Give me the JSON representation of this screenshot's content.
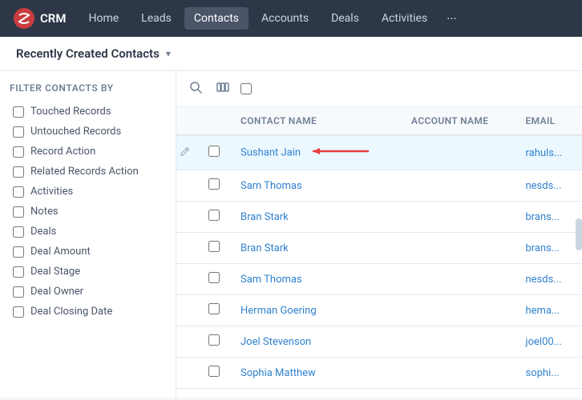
{
  "app": {
    "logo_text": "CRM",
    "nav_items": [
      {
        "label": "Home",
        "active": false
      },
      {
        "label": "Leads",
        "active": false
      },
      {
        "label": "Contacts",
        "active": true
      },
      {
        "label": "Accounts",
        "active": false
      },
      {
        "label": "Deals",
        "active": false
      },
      {
        "label": "Activities",
        "active": false
      }
    ],
    "nav_more": "···"
  },
  "sub_header": {
    "title": "Recently Created Contacts",
    "arrow": "▾"
  },
  "sidebar": {
    "title": "Filter Contacts by",
    "filters": [
      {
        "label": "Touched Records"
      },
      {
        "label": "Untouched Records"
      },
      {
        "label": "Record Action"
      },
      {
        "label": "Related Records Action"
      },
      {
        "label": "Activities"
      },
      {
        "label": "Notes"
      },
      {
        "label": "Deals"
      },
      {
        "label": "Deal Amount"
      },
      {
        "label": "Deal Stage"
      },
      {
        "label": "Deal Owner"
      },
      {
        "label": "Deal Closing Date"
      }
    ]
  },
  "table": {
    "columns": [
      {
        "key": "name",
        "label": "Contact Name"
      },
      {
        "key": "account",
        "label": "Account Name"
      },
      {
        "key": "email",
        "label": "Email"
      }
    ],
    "rows": [
      {
        "name": "Sushant Jain",
        "account": "",
        "email": "rahuls...",
        "highlighted": true
      },
      {
        "name": "Sam Thomas",
        "account": "",
        "email": "nesds...",
        "highlighted": false
      },
      {
        "name": "Bran Stark",
        "account": "",
        "email": "brans...",
        "highlighted": false
      },
      {
        "name": "Bran Stark",
        "account": "",
        "email": "brans...",
        "highlighted": false
      },
      {
        "name": "Sam Thomas",
        "account": "",
        "email": "nesds...",
        "highlighted": false
      },
      {
        "name": "Herman Goering",
        "account": "",
        "email": "hema...",
        "highlighted": false
      },
      {
        "name": "Joel Stevenson",
        "account": "",
        "email": "joel00...",
        "highlighted": false
      },
      {
        "name": "Sophia Matthew",
        "account": "",
        "email": "sophi...",
        "highlighted": false
      }
    ]
  }
}
